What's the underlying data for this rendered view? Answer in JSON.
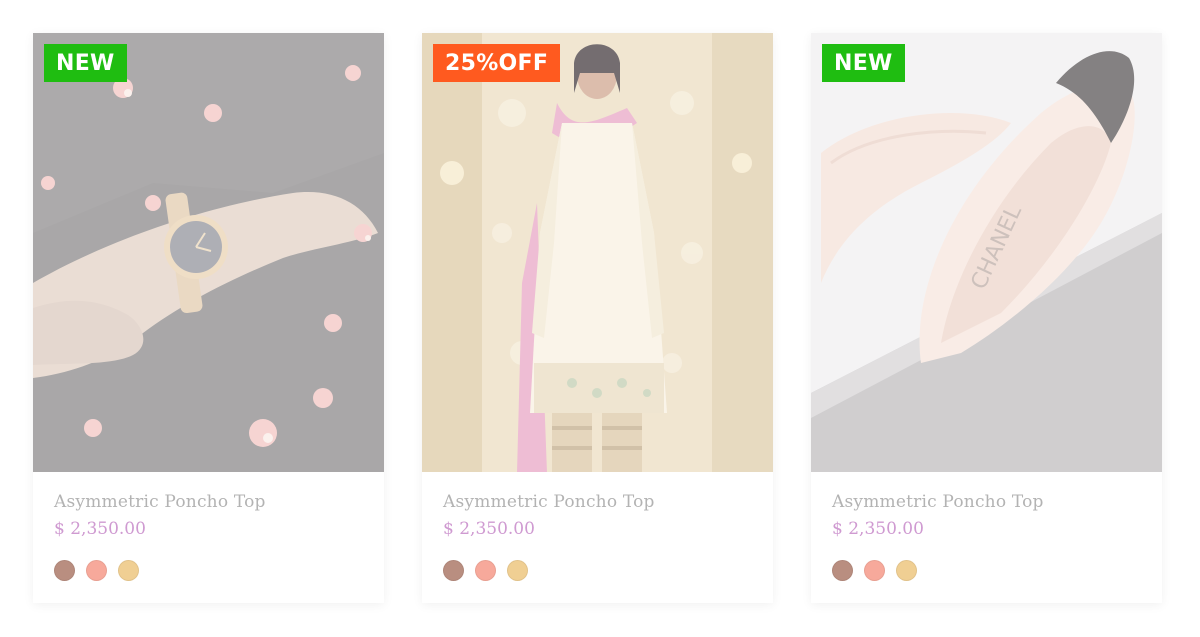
{
  "products": [
    {
      "badge": "NEW",
      "badge_color": "#1fbd11",
      "image": "wristwatch-photo",
      "title": "Asymmetric Poncho Top",
      "price": "$ 2,350.00",
      "swatches": [
        "#b98e80",
        "#f7a99b",
        "#f0cf93"
      ]
    },
    {
      "badge": "25%OFF",
      "badge_color": "#ff5a1f",
      "image": "embroidered-dress-photo",
      "title": "Asymmetric Poncho Top",
      "price": "$ 2,350.00",
      "swatches": [
        "#b98e80",
        "#f7a99b",
        "#f0cf93"
      ]
    },
    {
      "badge": "NEW",
      "badge_color": "#1fbd11",
      "image": "heels-photo",
      "title": "Asymmetric Poncho Top",
      "price": "$ 2,350.00",
      "swatches": [
        "#b98e80",
        "#f7a99b",
        "#f0cf93"
      ]
    }
  ]
}
